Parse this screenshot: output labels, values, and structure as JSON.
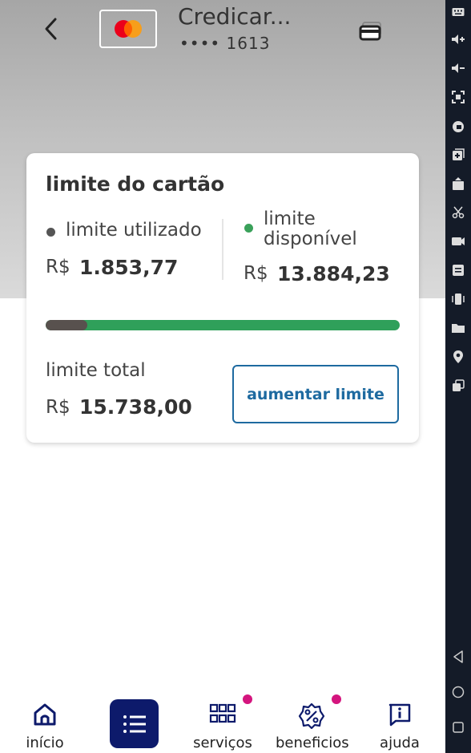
{
  "header": {
    "card_name": "Credicar...",
    "card_number": "•••• 1613"
  },
  "limit_card": {
    "title": "limite do cartão",
    "used": {
      "label": "limite utilizado",
      "currency": "R$",
      "amount": "1.853,77",
      "color": "#555555"
    },
    "available": {
      "label": "limite disponível",
      "currency": "R$",
      "amount": "13.884,23",
      "color": "#3aa15a"
    },
    "progress_used_fraction": 0.118,
    "total": {
      "label": "limite total",
      "currency": "R$",
      "amount": "15.738,00"
    },
    "raise_button": "aumentar limite"
  },
  "bottom_nav": {
    "items": [
      {
        "label": "início",
        "icon": "home-icon"
      },
      {
        "label": "",
        "icon": "list-icon"
      },
      {
        "label": "serviços",
        "icon": "grid-icon",
        "badge": true
      },
      {
        "label": "beneficios",
        "icon": "percent-badge-icon",
        "badge": true
      },
      {
        "label": "ajuda",
        "icon": "info-chat-icon"
      }
    ]
  },
  "colors": {
    "accent_blue": "#1e6aa0",
    "nav_active": "#0d1a6b",
    "progress_available": "#2fa05a",
    "badge": "#d4157e"
  },
  "side_toolbar": {
    "icons": [
      "keyboard-icon",
      "volume-up-icon",
      "volume-down-icon",
      "screenshot-icon",
      "lock-rotation-icon",
      "add-window-icon",
      "apk-install-icon",
      "cut-icon",
      "record-video-icon",
      "message-icon",
      "shake-icon",
      "folder-icon",
      "location-icon",
      "multi-window-icon",
      "back-nav-icon",
      "home-nav-icon",
      "recents-nav-icon"
    ]
  }
}
